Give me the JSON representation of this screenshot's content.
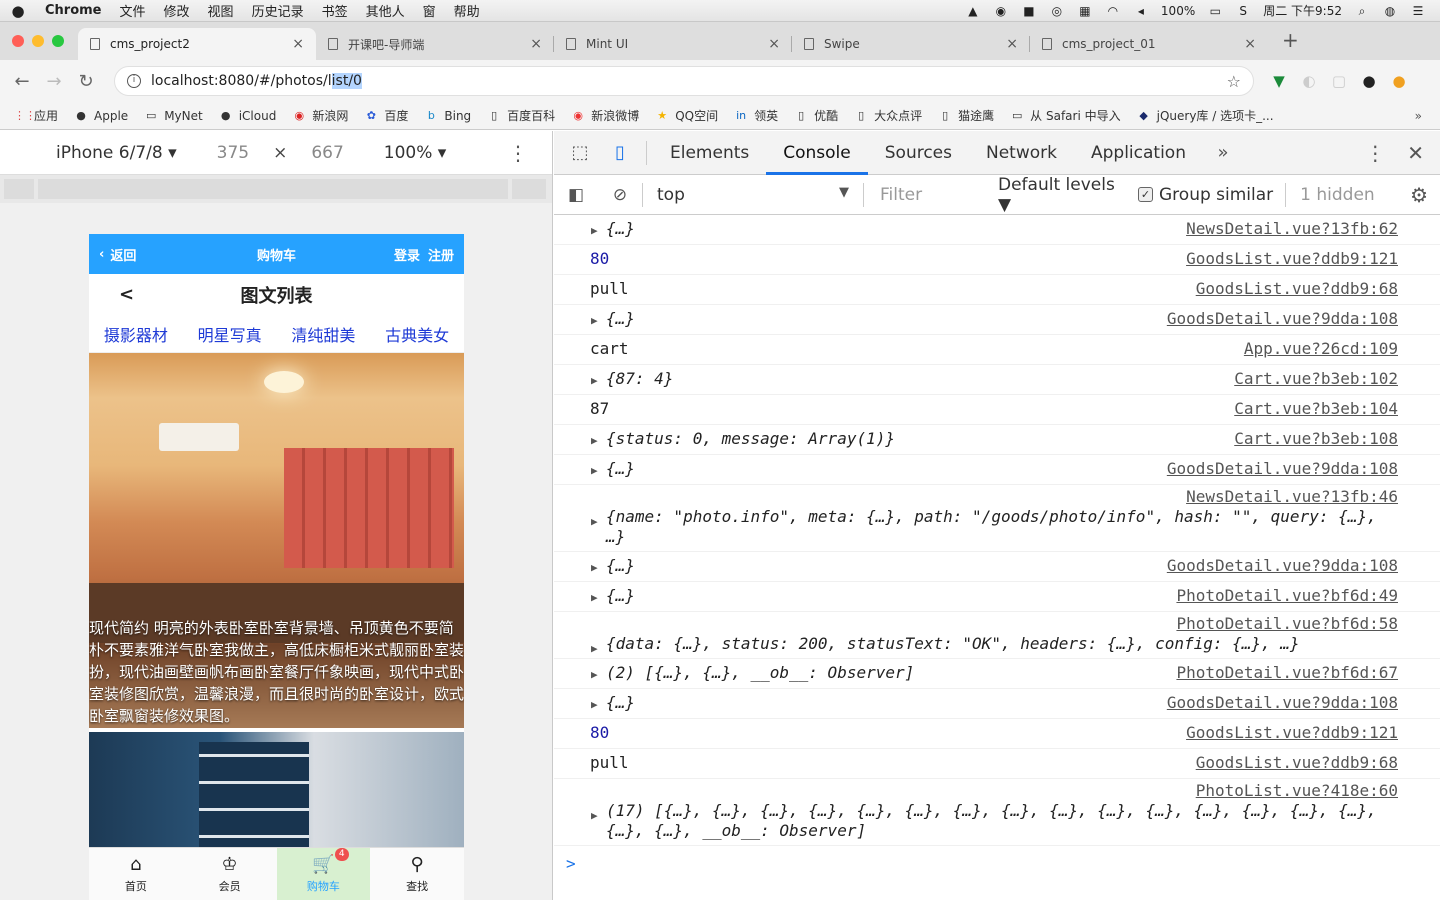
{
  "menubar": {
    "app": "Chrome",
    "items": [
      "文件",
      "修改",
      "视图",
      "历史记录",
      "书签",
      "其他人",
      "窗",
      "帮助"
    ],
    "battery": "100%",
    "clock": "周二 下午9:52"
  },
  "tabs": [
    {
      "title": "cms_project2",
      "active": true
    },
    {
      "title": "开课吧-导师端",
      "active": false
    },
    {
      "title": "Mint UI",
      "active": false
    },
    {
      "title": "Swipe",
      "active": false
    },
    {
      "title": "cms_project_01",
      "active": false
    }
  ],
  "address": {
    "url_prefix": "localhost:8080/#/photos/l",
    "url_selected": "ist/0"
  },
  "bookmarks": [
    "应用",
    "Apple",
    "MyNet",
    "iCloud",
    "新浪网",
    "百度",
    "Bing",
    "百度百科",
    "新浪微博",
    "QQ空间",
    "领英",
    "优酷",
    "大众点评",
    "猫途鹰",
    "从 Safari 中导入",
    "jQuery库 / 选项卡_..."
  ],
  "device": {
    "model": "iPhone 6/7/8",
    "width": "375",
    "times": "×",
    "height": "667",
    "zoom": "100%"
  },
  "mobile": {
    "header_back": "返回",
    "header_title": "购物车",
    "header_login": "登录",
    "header_register": "注册",
    "page_back": "<",
    "page_title": "图文列表",
    "categories": [
      "摄影器材",
      "明星写真",
      "清纯甜美",
      "古典美女"
    ],
    "photo_caption": "现代简约 明亮的外表卧室卧室背景墙、吊顶黄色不要简朴不要素雅洋气卧室我做主，高低床橱柜米式靓丽卧室装扮，现代油画壁画帆布画卧室餐厅仟象映画，现代中式卧室装修图欣赏，温馨浪漫，而且很时尚的卧室设计，欧式卧室飘窗装修效果图。",
    "tabbar": [
      {
        "label": "首页",
        "icon": "home-icon"
      },
      {
        "label": "会员",
        "icon": "member-icon"
      },
      {
        "label": "购物车",
        "icon": "cart-icon",
        "badge": "4",
        "active": true
      },
      {
        "label": "查找",
        "icon": "search-icon"
      }
    ]
  },
  "devtools": {
    "tabs": [
      "Elements",
      "Console",
      "Sources",
      "Network",
      "Application"
    ],
    "active_tab": "Console",
    "context": "top",
    "filter_placeholder": "Filter",
    "levels": "Default levels ▼",
    "group_similar": "Group similar",
    "hidden": "1 hidden"
  },
  "console_rows": [
    {
      "msg": "{…}",
      "src": "NewsDetail.vue?13fb:62",
      "obj": true
    },
    {
      "msg": "80",
      "src": "GoodsList.vue?ddb9:121",
      "kind": "num"
    },
    {
      "msg": "pull",
      "src": "GoodsList.vue?ddb9:68"
    },
    {
      "msg": "{…}",
      "src": "GoodsDetail.vue?9dda:108",
      "obj": true
    },
    {
      "msg": "cart",
      "src": "App.vue?26cd:109"
    },
    {
      "msg": "{87: 4}",
      "src": "Cart.vue?b3eb:102",
      "obj": true
    },
    {
      "msg": "87",
      "src": "Cart.vue?b3eb:104"
    },
    {
      "msg": "{status: 0, message: Array(1)}",
      "src": "Cart.vue?b3eb:108",
      "obj": true
    },
    {
      "msg": "{…}",
      "src": "GoodsDetail.vue?9dda:108",
      "obj": true
    },
    {
      "msg": "{name: \"photo.info\", meta: {…}, path: \"/goods/photo/info\", hash: \"\", query: {…}, …}",
      "src": "NewsDetail.vue?13fb:46",
      "obj": true,
      "tall": true
    },
    {
      "msg": "{…}",
      "src": "GoodsDetail.vue?9dda:108",
      "obj": true
    },
    {
      "msg": "{…}",
      "src": "PhotoDetail.vue?bf6d:49",
      "obj": true
    },
    {
      "msg": "{data: {…}, status: 200, statusText: \"OK\", headers: {…}, config: {…}, …}",
      "src": "PhotoDetail.vue?bf6d:58",
      "obj": true,
      "tall": true
    },
    {
      "msg": "(2) [{…}, {…}, __ob__: Observer]",
      "src": "PhotoDetail.vue?bf6d:67",
      "obj": true
    },
    {
      "msg": "{…}",
      "src": "GoodsDetail.vue?9dda:108",
      "obj": true
    },
    {
      "msg": "80",
      "src": "GoodsList.vue?ddb9:121",
      "kind": "num"
    },
    {
      "msg": "pull",
      "src": "GoodsList.vue?ddb9:68"
    },
    {
      "msg": "(17) [{…}, {…}, {…}, {…}, {…}, {…}, {…}, {…}, {…}, {…}, {…}, {…}, {…}, {…}, {…}, {…}, {…}, __ob__: Observer]",
      "src": "PhotoList.vue?418e:60",
      "obj": true,
      "tall": true
    }
  ],
  "console_prompt": ">"
}
